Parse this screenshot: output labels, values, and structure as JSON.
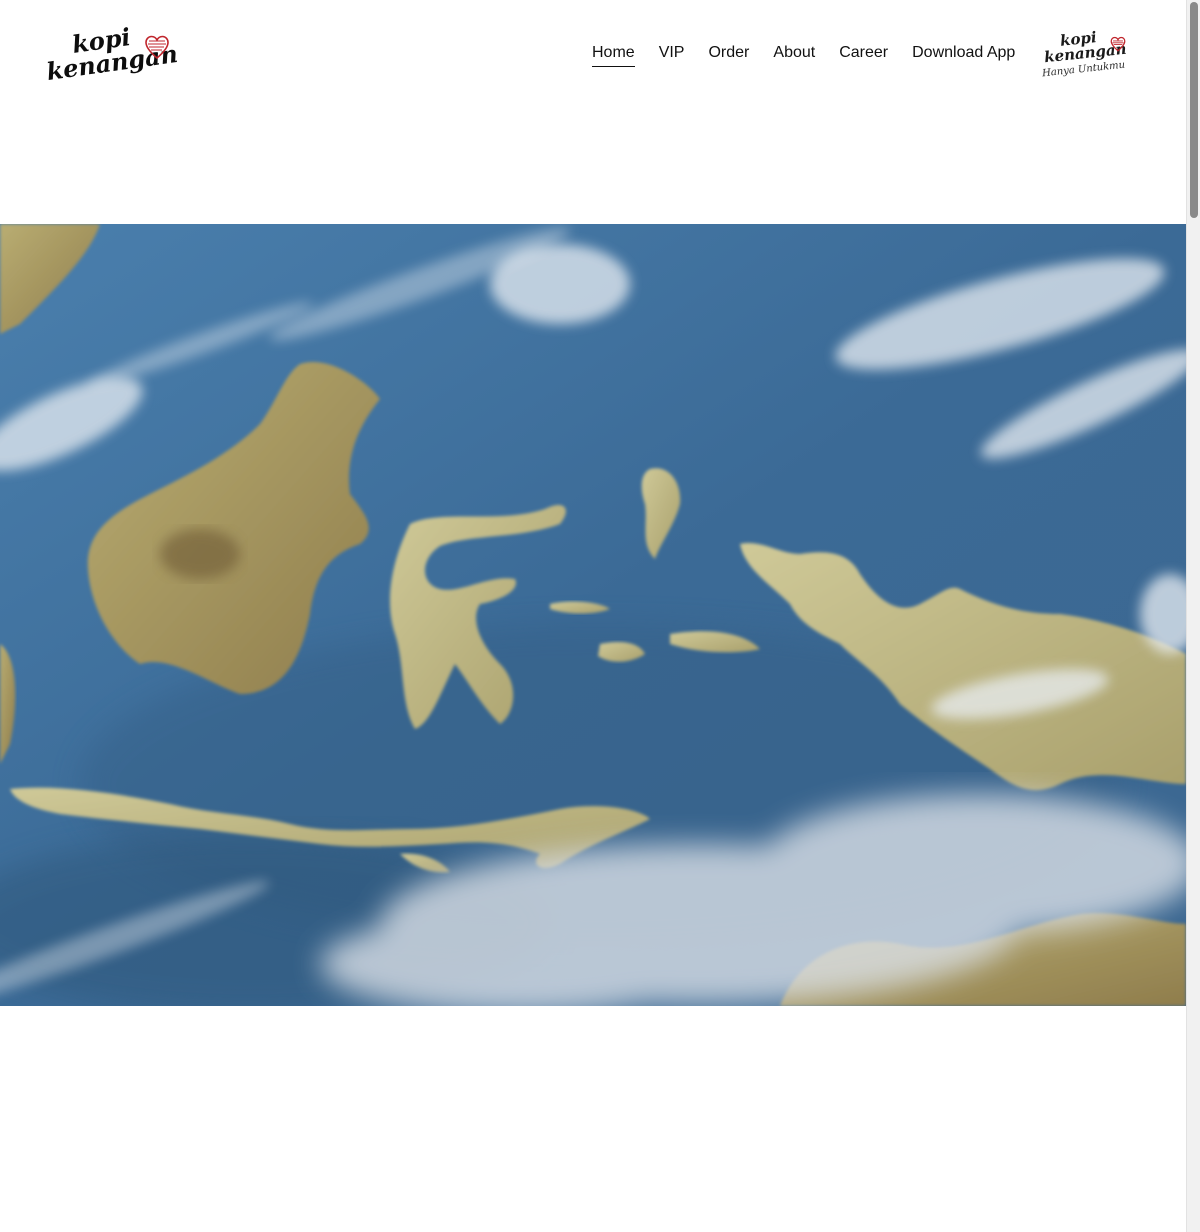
{
  "brand": {
    "logo_line1": "kopi",
    "logo_line2": "kenangan",
    "badge_line1": "kopi",
    "badge_line2": "kenangan",
    "badge_tagline": "Hanya Untukmu",
    "heart_color": "#c0262d"
  },
  "nav": {
    "items": [
      {
        "label": "Home",
        "active": true
      },
      {
        "label": "VIP",
        "active": false
      },
      {
        "label": "Order",
        "active": false
      },
      {
        "label": "About",
        "active": false
      },
      {
        "label": "Career",
        "active": false
      },
      {
        "label": "Download App",
        "active": false
      }
    ]
  },
  "hero": {
    "image": "satellite-map-of-indonesia",
    "ocean_color": "#3f6e99"
  }
}
